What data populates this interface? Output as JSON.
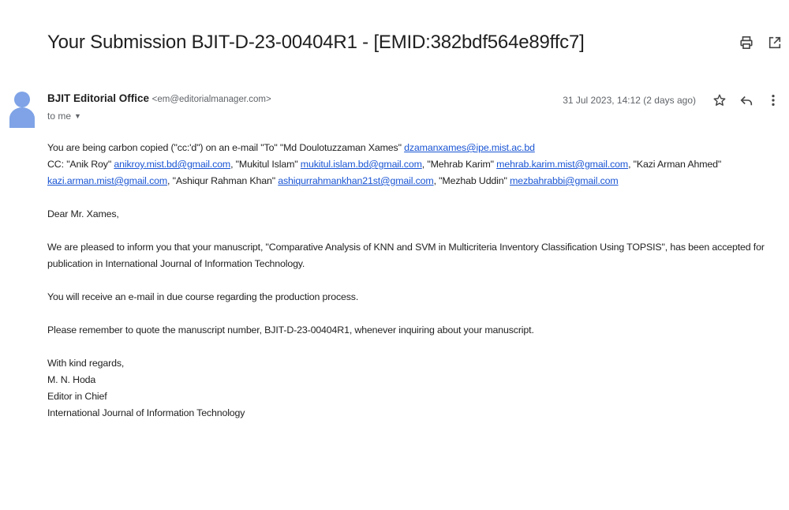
{
  "subject": "Your Submission BJIT-D-23-00404R1 - [EMID:382bdf564e89ffc7]",
  "icons": {
    "print": "print-icon",
    "popout": "open-in-new-window-icon",
    "star": "star-icon",
    "reply": "reply-icon",
    "more": "more-vertical-icon",
    "avatar": "person-avatar-icon"
  },
  "sender": {
    "name": "BJIT Editorial Office",
    "email": "<em@editorialmanager.com>"
  },
  "to_line": "to me",
  "date": "31 Jul 2023, 14:12 (2 days ago)",
  "body": {
    "cc_intro": "You are being carbon copied (\"cc:'d\") on an e-mail \"To\" \"Md Doulotuzzaman Xames\" ",
    "cc_intro_link": "dzamanxames@ipe.mist.ac.bd",
    "cc_prefix": "CC: ",
    "cc_entries": [
      {
        "name": "\"Anik Roy\" ",
        "email": "anikroy.mist.bd@gmail.com",
        "sep": ", "
      },
      {
        "name": "\"Mukitul Islam\" ",
        "email": "mukitul.islam.bd@gmail.com",
        "sep": ", "
      },
      {
        "name": "\"Mehrab Karim\" ",
        "email": "mehrab.karim.mist@gmail.com",
        "sep": ", "
      },
      {
        "name": "\"Kazi Arman Ahmed\" ",
        "email": "kazi.arman.mist@gmail.com",
        "sep": ","
      },
      {
        "name": "\"Ashiqur Rahman Khan\" ",
        "email": "ashiqurrahmankhan21st@gmail.com",
        "sep": ", "
      },
      {
        "name": "\"Mezhab Uddin\" ",
        "email": "mezbahrabbi@gmail.com",
        "sep": ""
      }
    ],
    "greeting": "Dear Mr. Xames,",
    "para1": "We are pleased to inform you that your manuscript, \"Comparative Analysis of KNN and SVM in Multicriteria Inventory Classification Using TOPSIS\", has been accepted for publication in International Journal of Information Technology.",
    "para2": "You will receive an e-mail in due course regarding the production process.",
    "para3": "Please remember to quote the manuscript number, BJIT-D-23-00404R1, whenever inquiring about your manuscript.",
    "signoff": "With kind regards,",
    "sig_name": "M. N. Hoda",
    "sig_title": "Editor in Chief",
    "sig_org": "International Journal of Information Technology"
  }
}
